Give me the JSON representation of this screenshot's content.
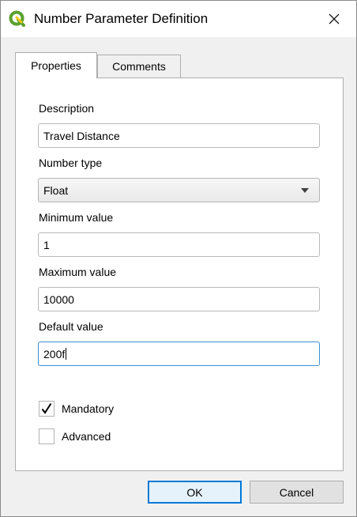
{
  "window": {
    "title": "Number Parameter Definition",
    "app_icon": "qgis-icon",
    "close_icon": "close-icon"
  },
  "tabs": [
    {
      "label": "Properties",
      "active": true
    },
    {
      "label": "Comments",
      "active": false
    }
  ],
  "form": {
    "description_label": "Description",
    "description_value": "Travel Distance",
    "number_type_label": "Number type",
    "number_type_value": "Float",
    "minimum_label": "Minimum value",
    "minimum_value": "1",
    "maximum_label": "Maximum value",
    "maximum_value": "10000",
    "default_label": "Default value",
    "default_value": "200f"
  },
  "options": {
    "mandatory_label": "Mandatory",
    "mandatory_checked": true,
    "advanced_label": "Advanced",
    "advanced_checked": false
  },
  "buttons": {
    "ok_label": "OK",
    "cancel_label": "Cancel"
  },
  "colors": {
    "focus_border": "#3c8fd8",
    "default_button_border": "#0078d7",
    "qgis_green": "#5aa02c"
  }
}
